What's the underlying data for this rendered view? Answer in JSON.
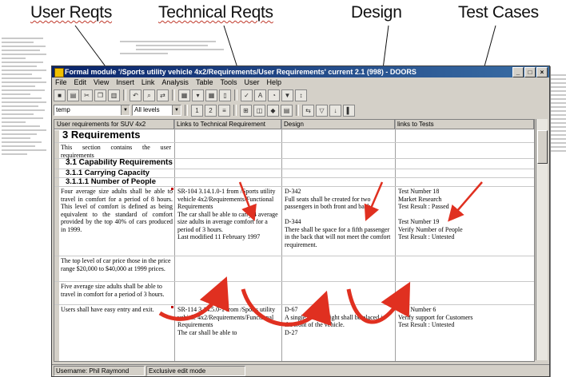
{
  "headers": [
    "User Reqts",
    "Technical Reqts",
    "Design",
    "Test Cases"
  ],
  "window": {
    "title": "Formal module '/Sports utility vehicle 4x2/Requirements/User Requirements' current 2.1 (998) - DOORS",
    "menu": [
      "File",
      "Edit",
      "View",
      "Insert",
      "Link",
      "Analysis",
      "Table",
      "Tools",
      "User",
      "Help"
    ],
    "view_combo": "temp",
    "levels_combo": "All levels",
    "columns": [
      "User requirements for SUV 4x2",
      "Links to Technical Requirement",
      "Design",
      "links to Tests"
    ],
    "status": [
      "Username: Phil Raymond",
      "Exclusive edit mode"
    ]
  },
  "rows": {
    "h1": "3 Requirements",
    "intro": "This section contains the user requirements",
    "h2": "3.1 Capability Requirements",
    "h3a": "3.1.1 Carrying Capacity",
    "h3b": "3.1.1.1 Number of People",
    "req1": {
      "user": "Four average size adults shall be able to travel in comfort for a period of 8 hours. This level of comfort is defined as being equivalent to the standard of comfort provided by the top 40% of cars produced in 1999.",
      "tech": "SR-104 3.14.1.0-1 from /Sports utility vehicle 4x2/Requirements/Functional Requirements\nThe car shall be able to carry 4 average size adults in average comfort for a period of 3 hours.\nLast modified 11 February 1997",
      "design": "D-342\nFull seats shall be created for two passengers in both front and back.\n\nD-344\nThere shall be space for a fifth passenger in the back that will not meet the comfort requirement.",
      "tests": "Test Number 18\nMarket Research\nTest Result : Passed\n\nTest Number 19\nVerify Number of People\nTest Result : Untested"
    },
    "req2": {
      "user": "The top level of car price those in the price range $20,000 to $40,000 at 1999 prices."
    },
    "req3": {
      "user": "Five average size adults shall be able to travel in comfort for a period of 3 hours."
    },
    "req4": {
      "user": "Users shall have easy entry and exit.",
      "tech": "SR-114 3.14.5.0-1 from /Sports utility vehicle 4x2/Requirements/Functional Requirements\nThe car shall be able to",
      "design": "D-67\nA single interior light shall be placed in the front of the vehicle.\nD-27",
      "tests": "Test Number 6\nVerify support for Customers\nTest Result : Untested"
    }
  },
  "colors": {
    "arrow": "#e03020",
    "titlebar": "#0a246a",
    "chrome": "#d4d0c8"
  }
}
